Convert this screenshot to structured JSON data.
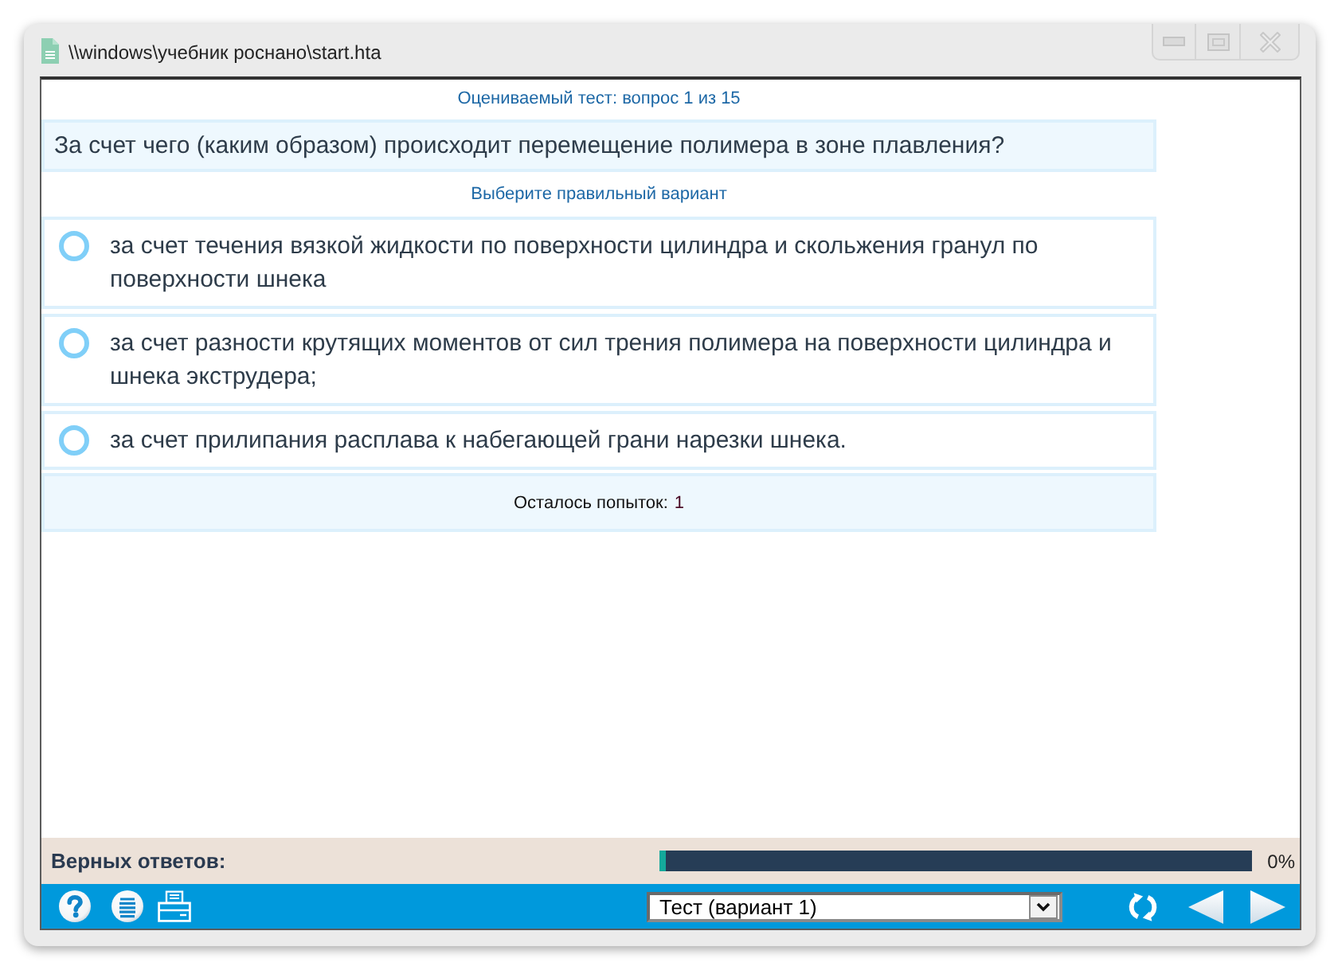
{
  "window": {
    "title": "\\\\windows\\учебник роснано\\start.hta"
  },
  "test": {
    "header": "Оцениваемый тест: вопрос 1 из 15",
    "question": "За счет чего (каким образом) происходит перемещение полимера в зоне плавления?",
    "instruction": "Выберите правильный вариант",
    "options": [
      {
        "text": "за счет течения вязкой жидкости по поверхности цилиндра и скольжения гранул по поверхности шнека",
        "selected": false
      },
      {
        "text": "за счет разности крутящих моментов от сил трения полимера на поверхности цилиндра и шнека экструдера;",
        "selected": false
      },
      {
        "text": "за счет прилипания расплава к набегающей грани нарезки шнека.",
        "selected": false
      }
    ],
    "attempts": {
      "label": "Осталось попыток:",
      "count": "1"
    }
  },
  "score": {
    "label": "Верных ответов:",
    "level": 0,
    "reading": "0%"
  },
  "toolbar": {
    "variant_select": {
      "value": "Тест (вариант 1)"
    }
  }
}
